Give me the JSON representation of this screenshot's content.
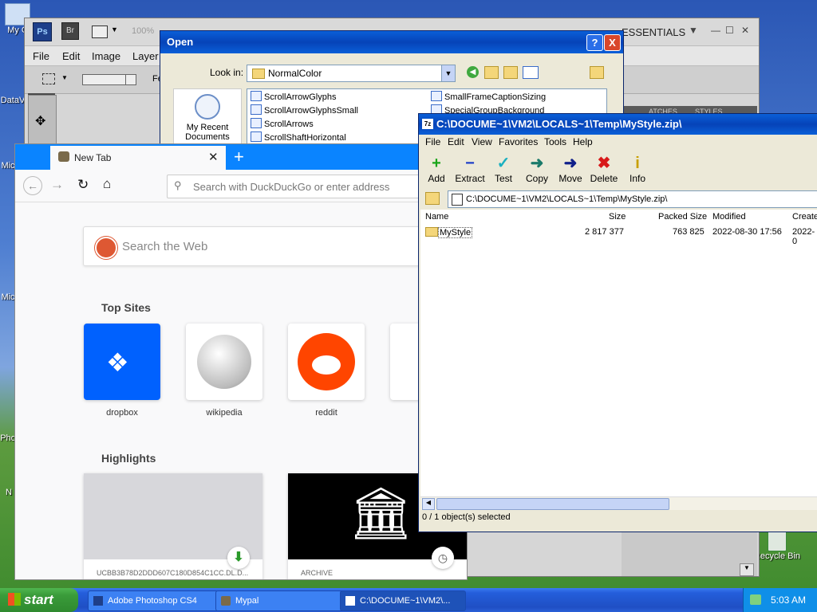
{
  "desktop": {
    "icons": [
      "My C",
      "DataV",
      "Mic",
      "Mic",
      "Pho",
      "N",
      "Recycle Bin"
    ]
  },
  "photoshop": {
    "ps_badge": "Ps",
    "br_badge": "Br",
    "zoom": "100%",
    "workspace": "ESSENTIALS",
    "menu": [
      "File",
      "Edit",
      "Image",
      "Layer"
    ],
    "option_fe": "Fe",
    "panel_tabs": [
      "ATCHES",
      "STYLES"
    ]
  },
  "open_dialog": {
    "title": "Open",
    "help_btn": "?",
    "close_btn": "X",
    "look_in_label": "Look in:",
    "look_in_value": "NormalColor",
    "recent_label": "My Recent Documents",
    "files_col1": [
      "ScrollArrowGlyphs",
      "ScrollArrowGlyphsSmall",
      "ScrollArrows",
      "ScrollShaftHorizontal"
    ],
    "files_col2": [
      "SmallFrameCaptionSizing",
      "SpecialGroupBackground"
    ]
  },
  "firefox": {
    "tab_title": "New Tab",
    "tab_close": "✕",
    "new_tab": "+",
    "url_placeholder": "Search with DuckDuckGo or enter address",
    "search_placeholder": "Search the Web",
    "top_sites_heading": "Top Sites",
    "top_sites": [
      {
        "label": "dropbox",
        "color": "#0061fe"
      },
      {
        "label": "wikipedia",
        "color": "#ffffff"
      },
      {
        "label": "reddit",
        "color": "#ff4500"
      }
    ],
    "highlights_heading": "Highlights",
    "highlights": [
      {
        "label": "UCBB3B78D2DDD607C180D854C1CC.DL.D..."
      },
      {
        "label": "ARCHIVE"
      }
    ]
  },
  "sevenzip": {
    "title": "C:\\DOCUME~1\\VM2\\LOCALS~1\\Temp\\MyStyle.zip\\",
    "menu": [
      "File",
      "Edit",
      "View",
      "Favorites",
      "Tools",
      "Help"
    ],
    "toolbar": [
      {
        "label": "Add",
        "icon": "+",
        "color": "#1aa51a"
      },
      {
        "label": "Extract",
        "icon": "−",
        "color": "#1a3cc8"
      },
      {
        "label": "Test",
        "icon": "✓",
        "color": "#1ab0c0"
      },
      {
        "label": "Copy",
        "icon": "➜",
        "color": "#1a7a6a"
      },
      {
        "label": "Move",
        "icon": "➜",
        "color": "#10208a"
      },
      {
        "label": "Delete",
        "icon": "✖",
        "color": "#d81a1a"
      },
      {
        "label": "Info",
        "icon": "i",
        "color": "#c8a000"
      }
    ],
    "address": "C:\\DOCUME~1\\VM2\\LOCALS~1\\Temp\\MyStyle.zip\\",
    "columns": [
      "Name",
      "Size",
      "Packed Size",
      "Modified",
      "Create"
    ],
    "rows": [
      {
        "name": "MyStyle",
        "size": "2 817 377",
        "packed": "763 825",
        "modified": "2022-08-30 17:56",
        "created": "2022-0"
      }
    ],
    "status": "0 / 1 object(s) selected"
  },
  "taskbar": {
    "start": "start",
    "tasks": [
      "Adobe Photoshop CS4",
      "Mypal",
      "C:\\DOCUME~1\\VM2\\..."
    ],
    "clock": "5:03 AM"
  }
}
